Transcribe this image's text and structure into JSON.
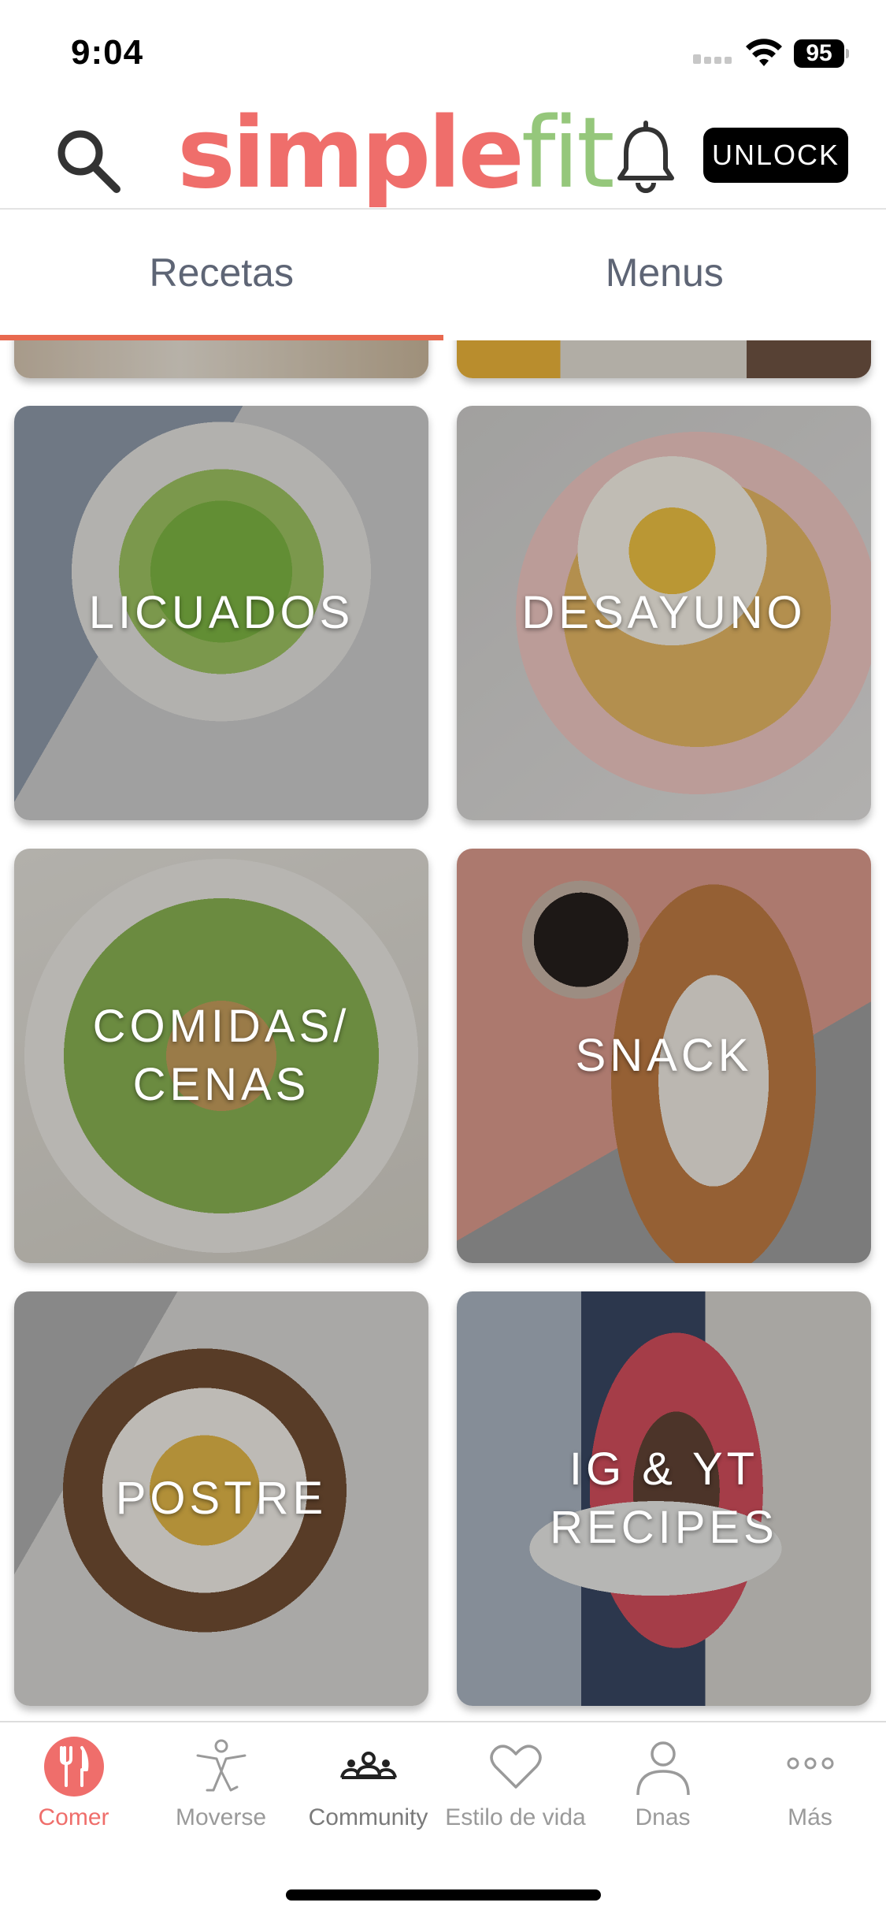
{
  "status_bar": {
    "time": "9:04",
    "battery": "95"
  },
  "header": {
    "logo_simple": "simple",
    "logo_fit": "fit",
    "unlock_label": "UNLOCK"
  },
  "tabs": [
    {
      "label": "Recetas",
      "active": true
    },
    {
      "label": "Menus",
      "active": false
    }
  ],
  "categories": [
    {
      "label": "LICUADOS"
    },
    {
      "label": "DESAYUNO"
    },
    {
      "label": "COMIDAS/\nCENAS"
    },
    {
      "label": "SNACK"
    },
    {
      "label": "POSTRE"
    },
    {
      "label": "IG & YT\nRECIPES"
    }
  ],
  "bottom_nav": [
    {
      "label": "Comer",
      "icon": "utensils-icon",
      "active": true
    },
    {
      "label": "Moverse",
      "icon": "exercise-figure-icon",
      "active": false
    },
    {
      "label": "Community",
      "icon": "community-icon",
      "active": false
    },
    {
      "label": "Estilo de vida",
      "icon": "heart-icon",
      "active": false
    },
    {
      "label": "Dnas",
      "icon": "person-icon",
      "active": false
    },
    {
      "label": "Más",
      "icon": "more-dots-icon",
      "active": false
    }
  ],
  "colors": {
    "brand_simple": "#ef6e6b",
    "brand_fit": "#95c77b",
    "tab_indicator": "#e8694f",
    "nav_active": "#ef6e6b",
    "nav_inactive": "#9a9a9a"
  }
}
